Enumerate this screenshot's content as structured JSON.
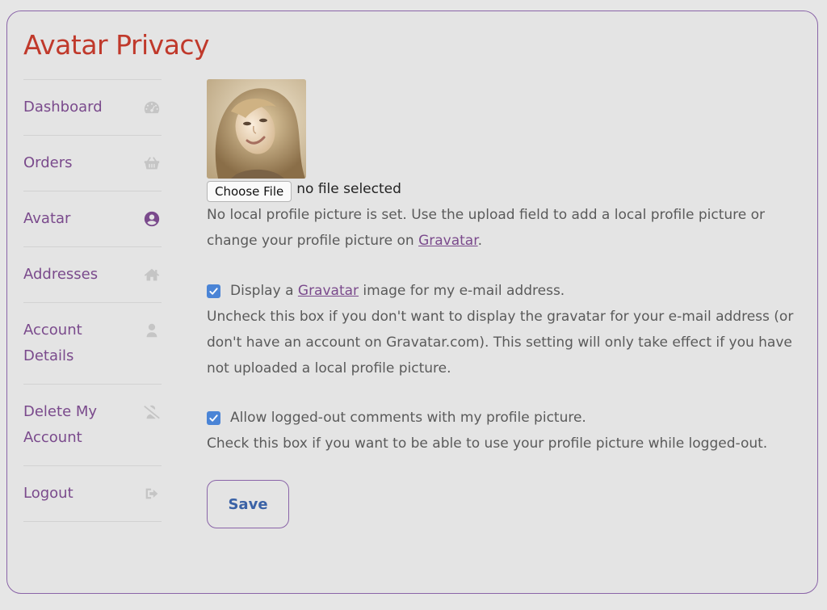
{
  "page": {
    "title": "Avatar Privacy"
  },
  "nav": {
    "items": [
      {
        "label": "Dashboard",
        "icon": "dashboard-gauge-icon"
      },
      {
        "label": "Orders",
        "icon": "basket-icon"
      },
      {
        "label": "Avatar",
        "icon": "user-circle-icon",
        "active": true
      },
      {
        "label": "Addresses",
        "icon": "home-icon"
      },
      {
        "label": "Account\nDetails",
        "icon": "user-icon"
      },
      {
        "label": "Delete My\nAccount",
        "icon": "user-slash-icon"
      },
      {
        "label": "Logout",
        "icon": "sign-out-icon"
      }
    ]
  },
  "upload": {
    "button_label": "Choose File",
    "status": "no file selected"
  },
  "intro": {
    "text_before": "No local profile picture is set. Use the upload field to add a local profile picture or change your profile picture on ",
    "link": "Gravatar",
    "text_after": "."
  },
  "gravatar_option": {
    "checked": true,
    "label_before": "Display a ",
    "label_link": "Gravatar",
    "label_after": " image for my e-mail address.",
    "description": "Uncheck this box if you don't want to display the gravatar for your e-mail address (or don't have an account on Gravatar.com). This setting will only take effect if you have not uploaded a local profile picture."
  },
  "comments_option": {
    "checked": true,
    "label": "Allow logged-out comments with my profile picture.",
    "description": "Check this box if you want to be able to use your profile picture while logged-out."
  },
  "save": {
    "label": "Save"
  },
  "colors": {
    "title": "#c0392b",
    "nav_text": "#7a4a8c",
    "checkbox": "#4a84d6",
    "save_text": "#3a62a6",
    "border": "#8a64a8"
  }
}
